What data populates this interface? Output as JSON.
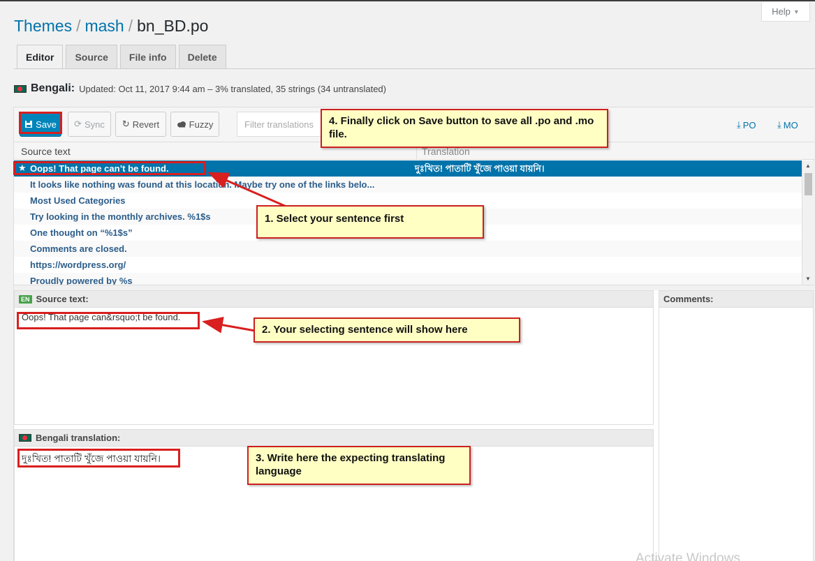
{
  "help": {
    "label": "Help",
    "caret": "▼"
  },
  "breadcrumb": {
    "items": [
      "Themes",
      "mash"
    ],
    "current": "bn_BD.po",
    "sep": "/"
  },
  "tabs": [
    {
      "label": "Editor",
      "active": true
    },
    {
      "label": "Source"
    },
    {
      "label": "File info"
    },
    {
      "label": "Delete"
    }
  ],
  "meta": {
    "language": "Bengali:",
    "info": "Updated: Oct 11, 2017 9:44 am – 3% translated, 35 strings (34 untranslated)"
  },
  "toolbar": {
    "save": "Save",
    "sync": "Sync",
    "revert": "Revert",
    "fuzzy": "Fuzzy",
    "filter_placeholder": "Filter translations",
    "po": "PO",
    "mo": "MO"
  },
  "list": {
    "col_source": "Source text",
    "col_translation": "Translation",
    "rows": [
      {
        "source": "Oops! That page can’t be found.",
        "translation": "দুঃখিত! পাতাটি খুঁজে পাওয়া যায়নি।"
      },
      {
        "source": "It looks like nothing was found at this location. Maybe try one of the links belo...",
        "translation": ""
      },
      {
        "source": "Most Used Categories",
        "translation": ""
      },
      {
        "source": "Try looking in the monthly archives. %1$s",
        "translation": ""
      },
      {
        "source": "One thought on “%1$s”",
        "translation": ""
      },
      {
        "source": "Comments are closed.",
        "translation": ""
      },
      {
        "source": "https://wordpress.org/",
        "translation": ""
      },
      {
        "source": "Proudly powered by %s",
        "translation": ""
      }
    ]
  },
  "source_pane": {
    "badge": "EN",
    "title": "Source text:",
    "text": "Oops! That page can&rsquo;t be found."
  },
  "translation_pane": {
    "title": "Bengali translation:",
    "text": "দুঃখিত! পাতাটি খুঁজে পাওয়া যায়নি।"
  },
  "comments_pane": {
    "title": "Comments:"
  },
  "annotations": {
    "a1": "1. Select your sentence first",
    "a2": "2. Your selecting sentence will show here",
    "a3": "3. Write here the expecting translating language",
    "a4": "4. Finally click on Save button to save all .po and .mo file."
  },
  "watermark": "Activate Windows",
  "colors": {
    "accent": "#0073aa",
    "annotation_border": "#cc1f1f",
    "annotation_bg": "#ffffc4"
  }
}
